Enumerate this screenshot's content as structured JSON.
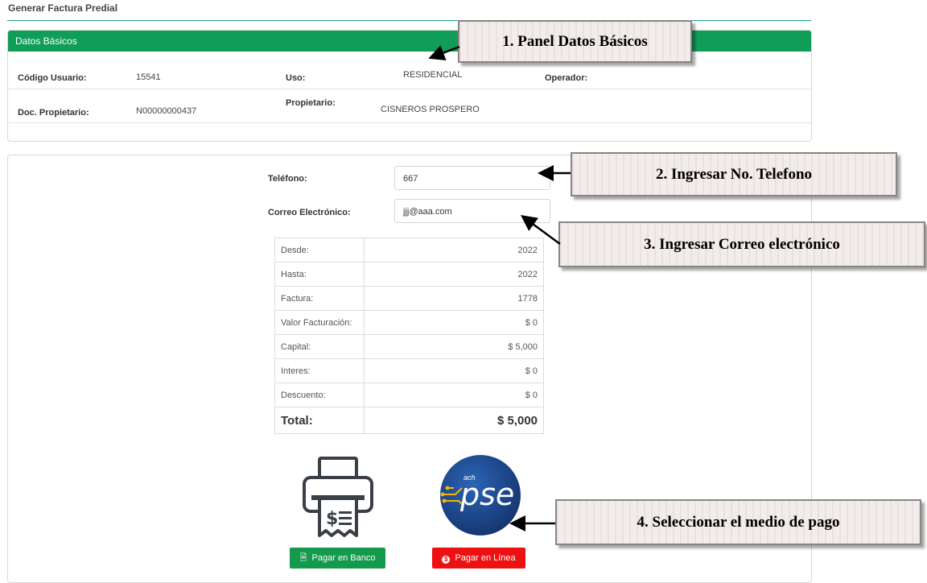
{
  "page": {
    "title": "Generar Factura Predial"
  },
  "basic_panel": {
    "heading": "Datos Básicos",
    "codigo_label": "Código Usuario:",
    "codigo_value": "15541",
    "uso_label": "Uso:",
    "uso_value": "RESIDENCIAL",
    "operador_label": "Operador:",
    "doc_label": "Doc. Propietario:",
    "doc_value": "N00000000437",
    "propietario_label": "Propietario:",
    "propietario_value": "CISNEROS  PROSPERO"
  },
  "contact": {
    "telefono_label": "Teléfono:",
    "telefono_value": "667",
    "correo_label": "Correo Electrónico:",
    "correo_value": "jjj@aaa.com"
  },
  "summary": {
    "rows": [
      {
        "label": "Desde:",
        "value": "2022"
      },
      {
        "label": "Hasta:",
        "value": "2022"
      },
      {
        "label": "Factura:",
        "value": "1778"
      },
      {
        "label": "Valor Facturación:",
        "value": "$ 0"
      },
      {
        "label": "Capital:",
        "value": "$ 5,000"
      },
      {
        "label": "Interes:",
        "value": "$ 0"
      },
      {
        "label": "Descuento:",
        "value": "$ 0"
      }
    ],
    "total_label": "Total:",
    "total_value": "$ 5,000"
  },
  "payment": {
    "bank_label": "Pagar en Banco",
    "online_label": "Pagar en Línea",
    "pse_small": "ach",
    "pse_text": "pse"
  },
  "callouts": {
    "c1": "1. Panel Datos Básicos",
    "c2": "2. Ingresar No. Telefono",
    "c3": "3. Ingresar Correo electrónico",
    "c4": "4. Seleccionar el medio de pago"
  },
  "colors": {
    "panel_heading": "#0f9d58",
    "bank_button": "#149a4c",
    "online_button": "#ee1111",
    "pse_blue": "#1c4a92"
  }
}
